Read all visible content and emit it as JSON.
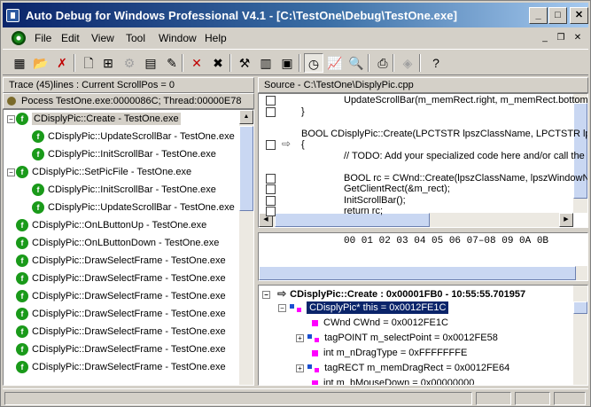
{
  "window": {
    "title": "Auto Debug for Windows Professional V4.1 - [C:\\TestOne\\Debug\\TestOne.exe]",
    "minimize": "_",
    "maximize": "□",
    "close": "✕"
  },
  "menu": {
    "items": [
      "File",
      "Edit",
      "View",
      "Tool",
      "Window",
      "Help"
    ],
    "mdi_min": "_",
    "mdi_restore": "❐",
    "mdi_close": "✕"
  },
  "toolbar": {
    "icons": [
      "open-project-icon",
      "open-folder-icon",
      "close-project-icon",
      "new-file-icon",
      "module-tree-icon",
      "disabled-gear-icon",
      "properties-icon",
      "edit-icon",
      "remove-icon",
      "clear-all-icon",
      "settings-tools-icon",
      "report-icon",
      "export-icon",
      "clock-icon",
      "trace-chart-icon",
      "find-icon",
      "print-icon",
      "disabled-plugin-icon",
      "help-icon"
    ],
    "glyphs": [
      "▦",
      "📂",
      "✗",
      "🗋",
      "⊞",
      "⚙",
      "▤",
      "✎",
      "✕",
      "✖",
      "⚒",
      "▥",
      "▣",
      "◷",
      "📈",
      "🔍",
      "⎙",
      "◈",
      "?"
    ]
  },
  "trace_panel": {
    "header": "Trace (45)lines : Current ScrollPos = 0",
    "process_row": "Pocess TestOne.exe:0000086C; Thread:00000E78",
    "rows": [
      {
        "label": "CDisplyPic::Create - TestOne.exe",
        "indent": 0,
        "toggle": "−"
      },
      {
        "label": "CDisplyPic::UpdateScrollBar - TestOne.exe",
        "indent": 1,
        "toggle": ""
      },
      {
        "label": "CDisplyPic::InitScrollBar - TestOne.exe",
        "indent": 1,
        "toggle": ""
      },
      {
        "label": "CDisplyPic::SetPicFile - TestOne.exe",
        "indent": 0,
        "toggle": "−"
      },
      {
        "label": "CDisplyPic::InitScrollBar - TestOne.exe",
        "indent": 1,
        "toggle": ""
      },
      {
        "label": "CDisplyPic::UpdateScrollBar - TestOne.exe",
        "indent": 1,
        "toggle": ""
      },
      {
        "label": "CDisplyPic::OnLButtonUp - TestOne.exe",
        "indent": 0,
        "toggle": ""
      },
      {
        "label": "CDisplyPic::OnLButtonDown - TestOne.exe",
        "indent": 0,
        "toggle": ""
      },
      {
        "label": "CDisplyPic::DrawSelectFrame - TestOne.exe",
        "indent": 0,
        "toggle": ""
      },
      {
        "label": "CDisplyPic::DrawSelectFrame - TestOne.exe",
        "indent": 0,
        "toggle": ""
      },
      {
        "label": "CDisplyPic::DrawSelectFrame - TestOne.exe",
        "indent": 0,
        "toggle": ""
      },
      {
        "label": "CDisplyPic::DrawSelectFrame - TestOne.exe",
        "indent": 0,
        "toggle": ""
      },
      {
        "label": "CDisplyPic::DrawSelectFrame - TestOne.exe",
        "indent": 0,
        "toggle": ""
      },
      {
        "label": "CDisplyPic::DrawSelectFrame - TestOne.exe",
        "indent": 0,
        "toggle": ""
      },
      {
        "label": "CDisplyPic::DrawSelectFrame - TestOne.exe",
        "indent": 0,
        "toggle": ""
      }
    ]
  },
  "source_panel": {
    "header": "Source - C:\\TestOne\\DisplyPic.cpp",
    "lines": [
      {
        "text": "UpdateScrollBar(m_memRect.right, m_memRect.bottom);",
        "indent": 2,
        "checkbox": true
      },
      {
        "text": "}",
        "indent": 1,
        "checkbox": true
      },
      {
        "text": "",
        "indent": 0,
        "checkbox": false
      },
      {
        "text": "BOOL CDisplyPic::Create(LPCTSTR lpszClassName, LPCTSTR lpszWindowName",
        "indent": 1,
        "checkbox": false
      },
      {
        "text": "{",
        "indent": 1,
        "checkbox": true,
        "arrow": true
      },
      {
        "text": "// TODO: Add your specialized code here and/or call the base class",
        "indent": 2,
        "checkbox": false
      },
      {
        "text": "",
        "indent": 0,
        "checkbox": false
      },
      {
        "text": "BOOL rc = CWnd::Create(lpszClassName, lpszWindowName, dwStyle",
        "indent": 2,
        "checkbox": true
      },
      {
        "text": "GetClientRect(&m_rect);",
        "indent": 2,
        "checkbox": true
      },
      {
        "text": "InitScrollBar();",
        "indent": 2,
        "checkbox": true
      },
      {
        "text": "return rc;",
        "indent": 2,
        "checkbox": true
      }
    ]
  },
  "hex_panel": {
    "header_row": "00  01  02  03  04  05  06  07–08  09  0A  0B"
  },
  "vars_panel": {
    "root": "CDisplyPic::Create : 0x00001FB0 - 10:55:55.701957",
    "selected": "CDisplyPic* this = 0x0012FE1C",
    "rows": [
      {
        "text": "CWnd CWnd = 0x0012FE1C",
        "kind": "member",
        "toggle": false
      },
      {
        "text": "tagPOINT m_selectPoint = 0x0012FE58",
        "kind": "struct",
        "toggle": true
      },
      {
        "text": "int m_nDragType = 0xFFFFFFFE",
        "kind": "member",
        "toggle": false
      },
      {
        "text": "tagRECT m_memDragRect = 0x0012FE64",
        "kind": "struct",
        "toggle": true
      },
      {
        "text": "int m_bMouseDown = 0x00000000",
        "kind": "member",
        "toggle": false
      }
    ]
  },
  "colors": {
    "title_start": "#0a246a",
    "title_end": "#a6caf0",
    "face": "#d4d0c8",
    "selection": "#0a246a",
    "tree_icon": "#1a9a1a",
    "member_marker": "#ff00ff"
  }
}
